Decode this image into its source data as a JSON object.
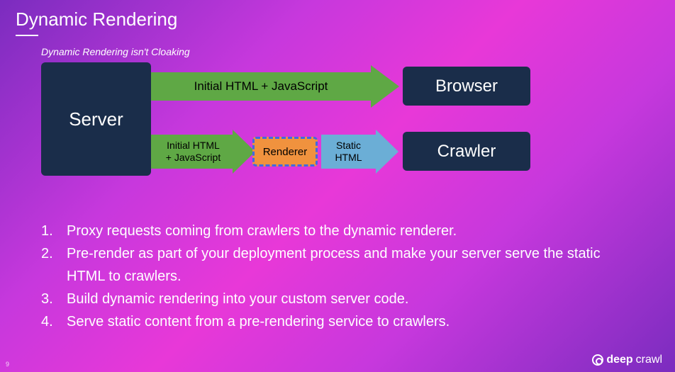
{
  "title": "Dynamic Rendering",
  "subtitle": "Dynamic Rendering isn't Cloaking",
  "diagram": {
    "server": "Server",
    "browser": "Browser",
    "crawler": "Crawler",
    "arrowTop": "Initial HTML + JavaScript",
    "arrowMidLine1": "Initial HTML",
    "arrowMidLine2": "+ JavaScript",
    "renderer": "Renderer",
    "arrowStaticLine1": "Static",
    "arrowStaticLine2": "HTML"
  },
  "list": [
    {
      "n": "1.",
      "text": "Proxy requests coming from crawlers to the dynamic renderer."
    },
    {
      "n": "2.",
      "text": "Pre-render as part of your deployment process and make your server serve the static HTML to crawlers."
    },
    {
      "n": "3.",
      "text": "Build dynamic rendering into your custom server code."
    },
    {
      "n": "4.",
      "text": "Serve static content from a pre-rendering service to crawlers."
    }
  ],
  "footer": {
    "bold": "deep",
    "thin": "crawl"
  },
  "pageNumber": "9"
}
